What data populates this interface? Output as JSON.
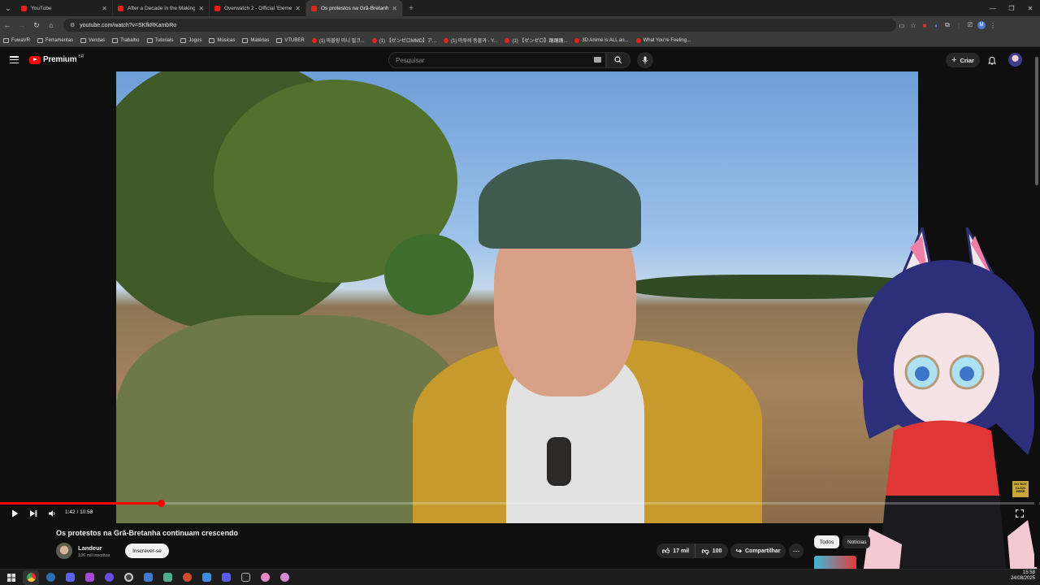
{
  "browser": {
    "tabs": [
      {
        "title": "YouTube"
      },
      {
        "title": "After a Decade in the Making..."
      },
      {
        "title": "Overwatch 2 - Official 'Element..."
      },
      {
        "title": "Os protestos na Grã-Bretanha c..."
      }
    ],
    "url": "youtube.com/watch?v=SKfkRKambRo",
    "bookmarks": [
      {
        "label": "FuwaVR",
        "kind": "folder"
      },
      {
        "label": "Ferramentas",
        "kind": "folder"
      },
      {
        "label": "Vendas",
        "kind": "folder"
      },
      {
        "label": "Trabalho",
        "kind": "folder"
      },
      {
        "label": "Tutoriais",
        "kind": "folder"
      },
      {
        "label": "Jogos",
        "kind": "folder"
      },
      {
        "label": "Músicas",
        "kind": "folder"
      },
      {
        "label": "Matérias",
        "kind": "folder"
      },
      {
        "label": "VTUBER",
        "kind": "folder"
      },
      {
        "label": "(1) 마블링 미니 필크...",
        "kind": "yt"
      },
      {
        "label": "(1) 【ゼンゼロMMD】ア...",
        "kind": "yt"
      },
      {
        "label": "(1) 마투비 동물과 - Y...",
        "kind": "yt"
      },
      {
        "label": "(1) 【ゼンゼロ】踊踊踊...",
        "kind": "yt"
      },
      {
        "label": "3D Anime is ALL an...",
        "kind": "yt"
      },
      {
        "label": "What You're Feeling...",
        "kind": "yt"
      }
    ]
  },
  "youtube": {
    "logo_text": "Premium",
    "country_code": "BR",
    "search_placeholder": "Pesquisar",
    "create_label": "Criar"
  },
  "player": {
    "time": "1:42 / 10:58",
    "progress_fraction": 0.155,
    "badge_text": "DO NOT CLICK HERE"
  },
  "video": {
    "title": "Os protestos na Grã-Bretanha continuam crescendo",
    "channel_name": "Landeur",
    "subscribers": "106 mil inscritos",
    "subscribe_label": "Inscrever-se",
    "likes": "17 mil",
    "dislikes": "100",
    "share_label": "Compartilhar"
  },
  "sidebar_chips": [
    {
      "label": "Todos"
    },
    {
      "label": "Notícias"
    }
  ],
  "taskbar": {
    "time": "15:58",
    "date": "24/08/2025"
  },
  "colors": {
    "youtube_red": "#ff0000",
    "background": "#0f0f0f",
    "chip_bg": "#272727"
  }
}
